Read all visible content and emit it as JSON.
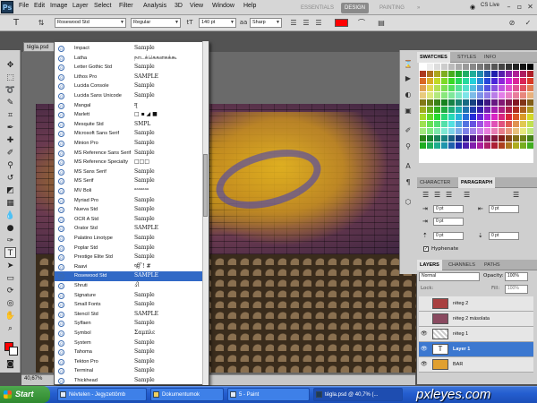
{
  "app": {
    "logo": "Ps"
  },
  "menu": [
    "File",
    "Edit",
    "Image",
    "Layer",
    "Select",
    "Filter",
    "Analysis",
    "3D",
    "View",
    "Window",
    "Help"
  ],
  "workspaces": [
    "ESSENTIALS",
    "DESIGN",
    "PAINTING",
    "»"
  ],
  "cslive": "CS Live",
  "options": {
    "font_family": "Rosewood Std",
    "font_style": "Regular",
    "font_size": "140 pt",
    "antialias": "Sharp",
    "text_color": "#ff0000"
  },
  "document": {
    "tab": "tégla.psd",
    "zoom": "40,67%"
  },
  "font_list": [
    {
      "name": "Impact",
      "sample": "Sample"
    },
    {
      "name": "Latha",
      "sample": "நாடக்கெகனகக்கூ"
    },
    {
      "name": "Letter Gothic Std",
      "sample": "Sample"
    },
    {
      "name": "Lithos Pro",
      "sample": "SAMPLE"
    },
    {
      "name": "Lucida Console",
      "sample": "Sample"
    },
    {
      "name": "Lucida Sans Unicode",
      "sample": "Sample"
    },
    {
      "name": "Mangal",
      "sample": "नृ"
    },
    {
      "name": "Marlett",
      "sample": "□ ▪ ◢ ■"
    },
    {
      "name": "Mesquite Std",
      "sample": "SMPL"
    },
    {
      "name": "Microsoft Sans Serif",
      "sample": "Sample"
    },
    {
      "name": "Minion Pro",
      "sample": "Sample"
    },
    {
      "name": "MS Reference Sans Serif",
      "sample": "Sample"
    },
    {
      "name": "MS Reference Specialty",
      "sample": "□□□"
    },
    {
      "name": "MS Sans Serif",
      "sample": "Sample"
    },
    {
      "name": "MS Serif",
      "sample": "Sample"
    },
    {
      "name": "MV Boli",
      "sample": "ᵃᵃᵃᵃᵃᵃᵃ"
    },
    {
      "name": "Myriad Pro",
      "sample": "Sample"
    },
    {
      "name": "Nueva Std",
      "sample": "Sample"
    },
    {
      "name": "OCR A Std",
      "sample": "Sample"
    },
    {
      "name": "Orator Std",
      "sample": "SAMPLE"
    },
    {
      "name": "Palatino Linotype",
      "sample": "Sample"
    },
    {
      "name": "Poplar Std",
      "sample": "Sample"
    },
    {
      "name": "Prestige Elite Std",
      "sample": "Sample"
    },
    {
      "name": "Raavi",
      "sample": "ੴ ! #"
    },
    {
      "name": "Rosewood Std",
      "sample": "SAMPLE"
    },
    {
      "name": "Shruti",
      "sample": "ઙી"
    },
    {
      "name": "Signature",
      "sample": "Sample"
    },
    {
      "name": "Small Fonts",
      "sample": "Sample"
    },
    {
      "name": "Stencil Std",
      "sample": "SAMPLE"
    },
    {
      "name": "Sylfaen",
      "sample": "Sample"
    },
    {
      "name": "Symbol",
      "sample": "Σαμπλε"
    },
    {
      "name": "System",
      "sample": "Sample"
    },
    {
      "name": "Tahoma",
      "sample": "Sample"
    },
    {
      "name": "Tekton Pro",
      "sample": "Sample"
    },
    {
      "name": "Terminal",
      "sample": "Sample"
    },
    {
      "name": "Thickhead",
      "sample": "Sample"
    }
  ],
  "panels": {
    "swatch_tabs": [
      "SWATCHES",
      "STYLES",
      "INFO"
    ],
    "char_tabs": [
      "CHARACTER",
      "PARAGRAPH"
    ],
    "paragraph": {
      "indent_left": "0 pt",
      "indent_right": "0 pt",
      "indent_first": "0 pt",
      "space_before": "0 pt",
      "space_after": "0 pt",
      "hyphenate": "Hyphenate"
    },
    "layer_tabs": [
      "LAYERS",
      "CHANNELS",
      "PATHS"
    ],
    "blend_mode": "Normal",
    "opacity_label": "Opacity:",
    "opacity": "100%",
    "lock_label": "Lock:",
    "fill_label": "Fill:",
    "fill": "100%",
    "layers": [
      "réteg 2",
      "réteg 2 másolata",
      "réteg 1",
      "Layer 1",
      "BAR"
    ]
  },
  "taskbar": {
    "start": "Start",
    "tasks": [
      "Névtelen - Jegyzettömb",
      "Dokumentumok",
      "5 - Paint",
      "tégla.psd @ 40,7% (..."
    ],
    "watermark": "pxleyes.com"
  }
}
